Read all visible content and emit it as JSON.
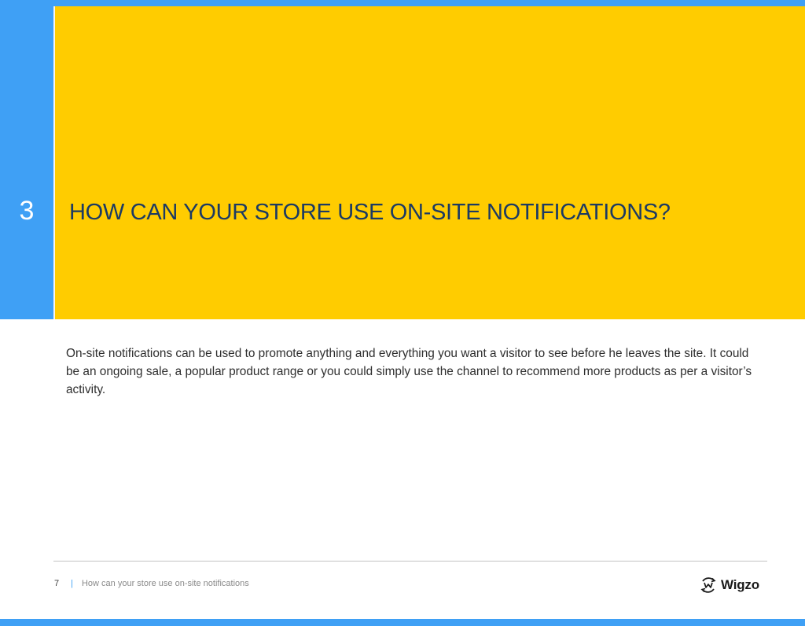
{
  "chapter": {
    "number": "3",
    "title": "HOW CAN YOUR STORE USE ON-SITE NOTIFICATIONS?"
  },
  "body": {
    "paragraph": "On-site notifications can be used to promote anything and everything you want a visitor to see before he leaves the site. It could be an ongoing sale, a popular product range or you could simply use the channel to recommend more products as per a visitor’s activity."
  },
  "footer": {
    "page_number": "7",
    "separator": "|",
    "caption": "How can your store use on-site notifications",
    "brand_name": "Wigzo",
    "brand_icon": "wigzo-logo-icon"
  },
  "colors": {
    "accent_blue": "#3fa0f5",
    "hero_yellow": "#ffcc00",
    "title_navy": "#1c3a63"
  }
}
